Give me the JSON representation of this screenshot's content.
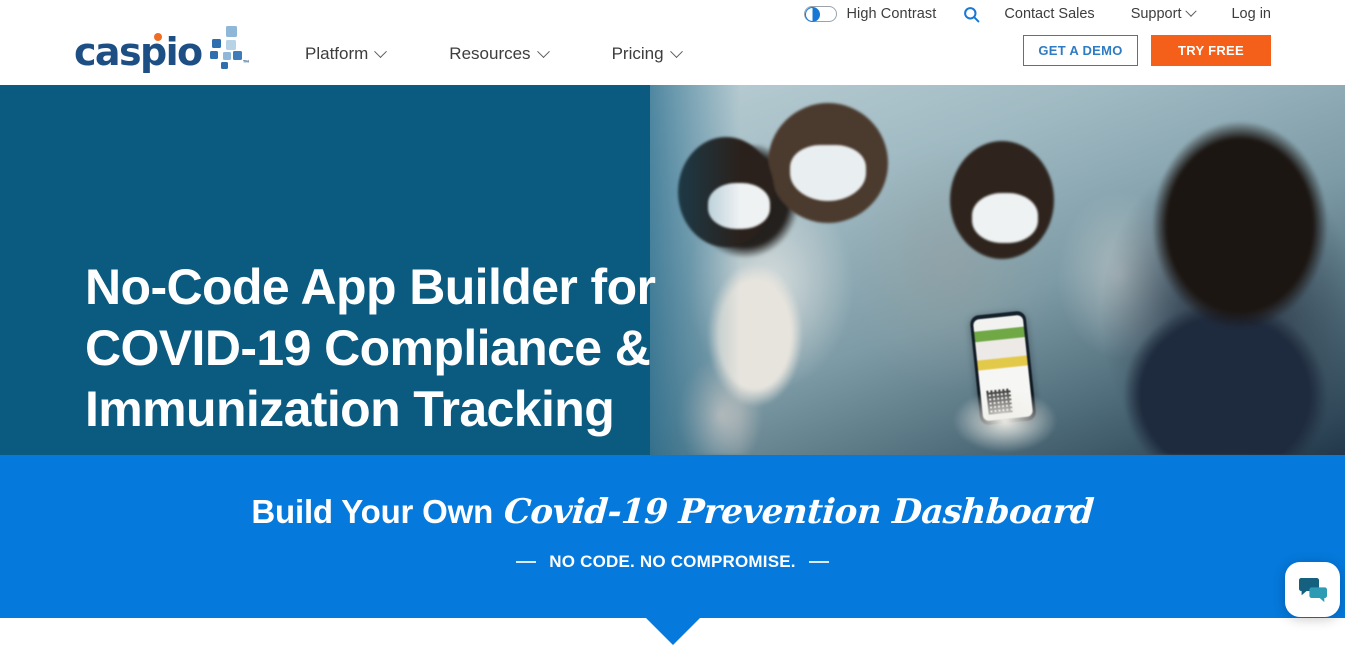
{
  "brand": {
    "logo_text": "caspio",
    "trademark": "™",
    "navy": "#1d4f84",
    "orange_dot": "#f06c23",
    "square_colors": [
      "#2f6fae",
      "#8fb8d8",
      "#2f6fae",
      "#b9d3e6",
      "#3d7cb8",
      "#2f6fae",
      "#8fb8d8"
    ]
  },
  "utility": {
    "high_contrast_label": "High Contrast",
    "search_icon": "search-icon",
    "contact_sales": "Contact Sales",
    "support": "Support",
    "login": "Log in",
    "chevron_icon": "chevron-down-icon"
  },
  "nav": {
    "items": [
      {
        "label": "Platform",
        "icon": "chevron-down-icon"
      },
      {
        "label": "Resources",
        "icon": "chevron-down-icon"
      },
      {
        "label": "Pricing",
        "icon": "chevron-down-icon"
      }
    ]
  },
  "header_ctas": {
    "demo_label": "GET A DEMO",
    "try_label": "TRY FREE",
    "demo_color": "#2e7cc4",
    "try_color": "#f4601a"
  },
  "hero": {
    "title_line1": "No-Code App Builder for",
    "title_line2": "COVID-19 Compliance &",
    "title_line3": "Immunization Tracking",
    "background_color": "#0b5a80",
    "image_alt": "masked people at a checkpoint with gloved hand scanning a QR code on a phone"
  },
  "band": {
    "title_plain": "Build Your Own",
    "title_script": "Covid-19 Prevention Dashboard",
    "subtitle": "NO CODE. NO COMPROMISE.",
    "background_color": "#0579dc",
    "scroll_icon": "chevron-down-notch-icon"
  },
  "chat": {
    "icon": "chat-bubbles-icon",
    "bubble_color": "#15607e",
    "bubble_accent": "#2e9bb5"
  }
}
